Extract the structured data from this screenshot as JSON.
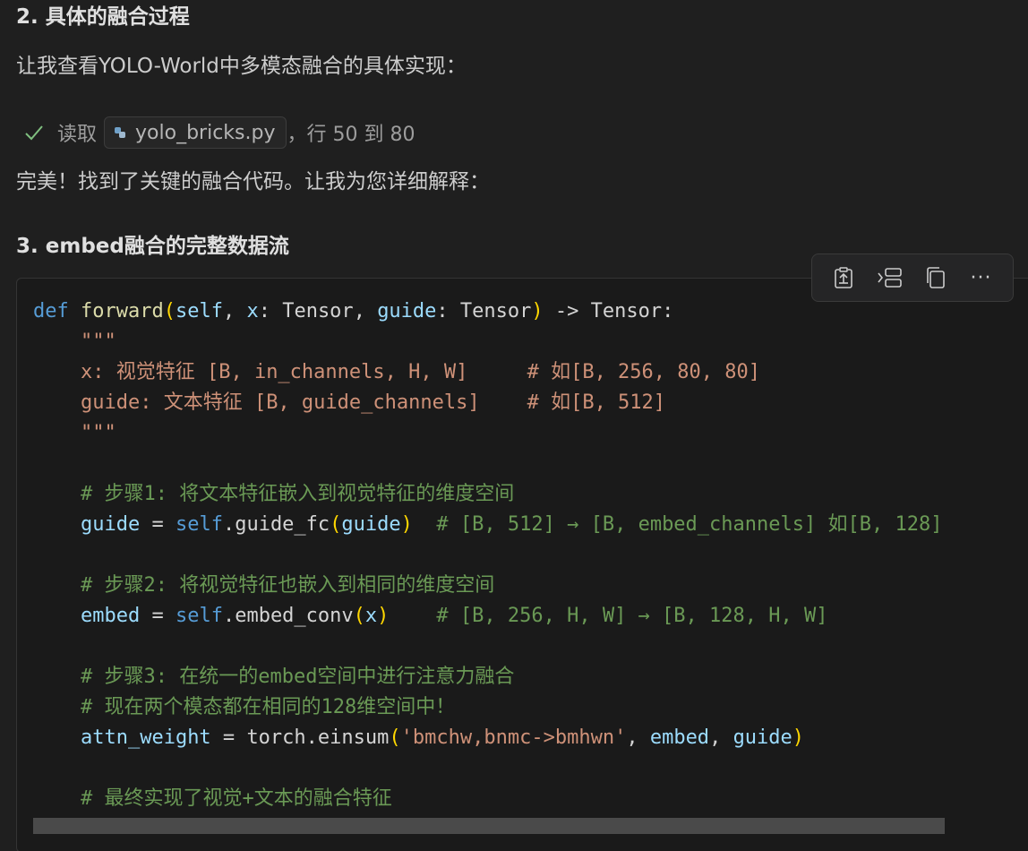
{
  "section2": {
    "heading": "2. 具体的融合过程",
    "intro": "让我查看YOLO-World中多模态融合的具体实现："
  },
  "read_action": {
    "status_icon": "check-icon",
    "label": "读取",
    "file_icon": "python-file-icon",
    "file_name": "yolo_bricks.py",
    "range": "，行 50 到 80"
  },
  "summary": "完美！找到了关键的融合代码。让我为您详细解释：",
  "section3": {
    "heading": "3. embed融合的完整数据流"
  },
  "code_toolbar": {
    "buttons": [
      "insert-into-file-icon",
      "insert-at-cursor-icon",
      "copy-icon",
      "more-icon"
    ],
    "more_label": "···"
  },
  "code": {
    "language": "python",
    "l1": {
      "kw": "def",
      "fn": "forward",
      "p1": "self",
      "p2": "x",
      "t1": "Tensor",
      "p3": "guide",
      "t2": "Tensor",
      "arrow": " -> ",
      "ret": "Tensor"
    },
    "l2": "\"\"\"",
    "l3": "x: 视觉特征 [B, in_channels, H, W]     # 如[B, 256, 80, 80]",
    "l4": "guide: 文本特征 [B, guide_channels]    # 如[B, 512]",
    "l5": "\"\"\"",
    "l7": "# 步骤1: 将文本特征嵌入到视觉特征的维度空间",
    "l8": {
      "var": "guide",
      "obj": "self",
      "method": "guide_fc",
      "arg": "guide",
      "comment": "# [B, 512] → [B, embed_channels] 如[B, 128]"
    },
    "l10": "# 步骤2: 将视觉特征也嵌入到相同的维度空间",
    "l11": {
      "var": "embed",
      "obj": "self",
      "method": "embed_conv",
      "arg": "x",
      "comment": "# [B, 256, H, W] → [B, 128, H, W]"
    },
    "l13": "# 步骤3: 在统一的embed空间中进行注意力融合",
    "l14": "# 现在两个模态都在相同的128维空间中！",
    "l15": {
      "var": "attn_weight",
      "obj": "torch",
      "method": "einsum",
      "str": "'bmchw,bnmc->bmhwn'",
      "a1": "embed",
      "a2": "guide"
    },
    "l17": "# 最终实现了视觉+文本的融合特征"
  }
}
